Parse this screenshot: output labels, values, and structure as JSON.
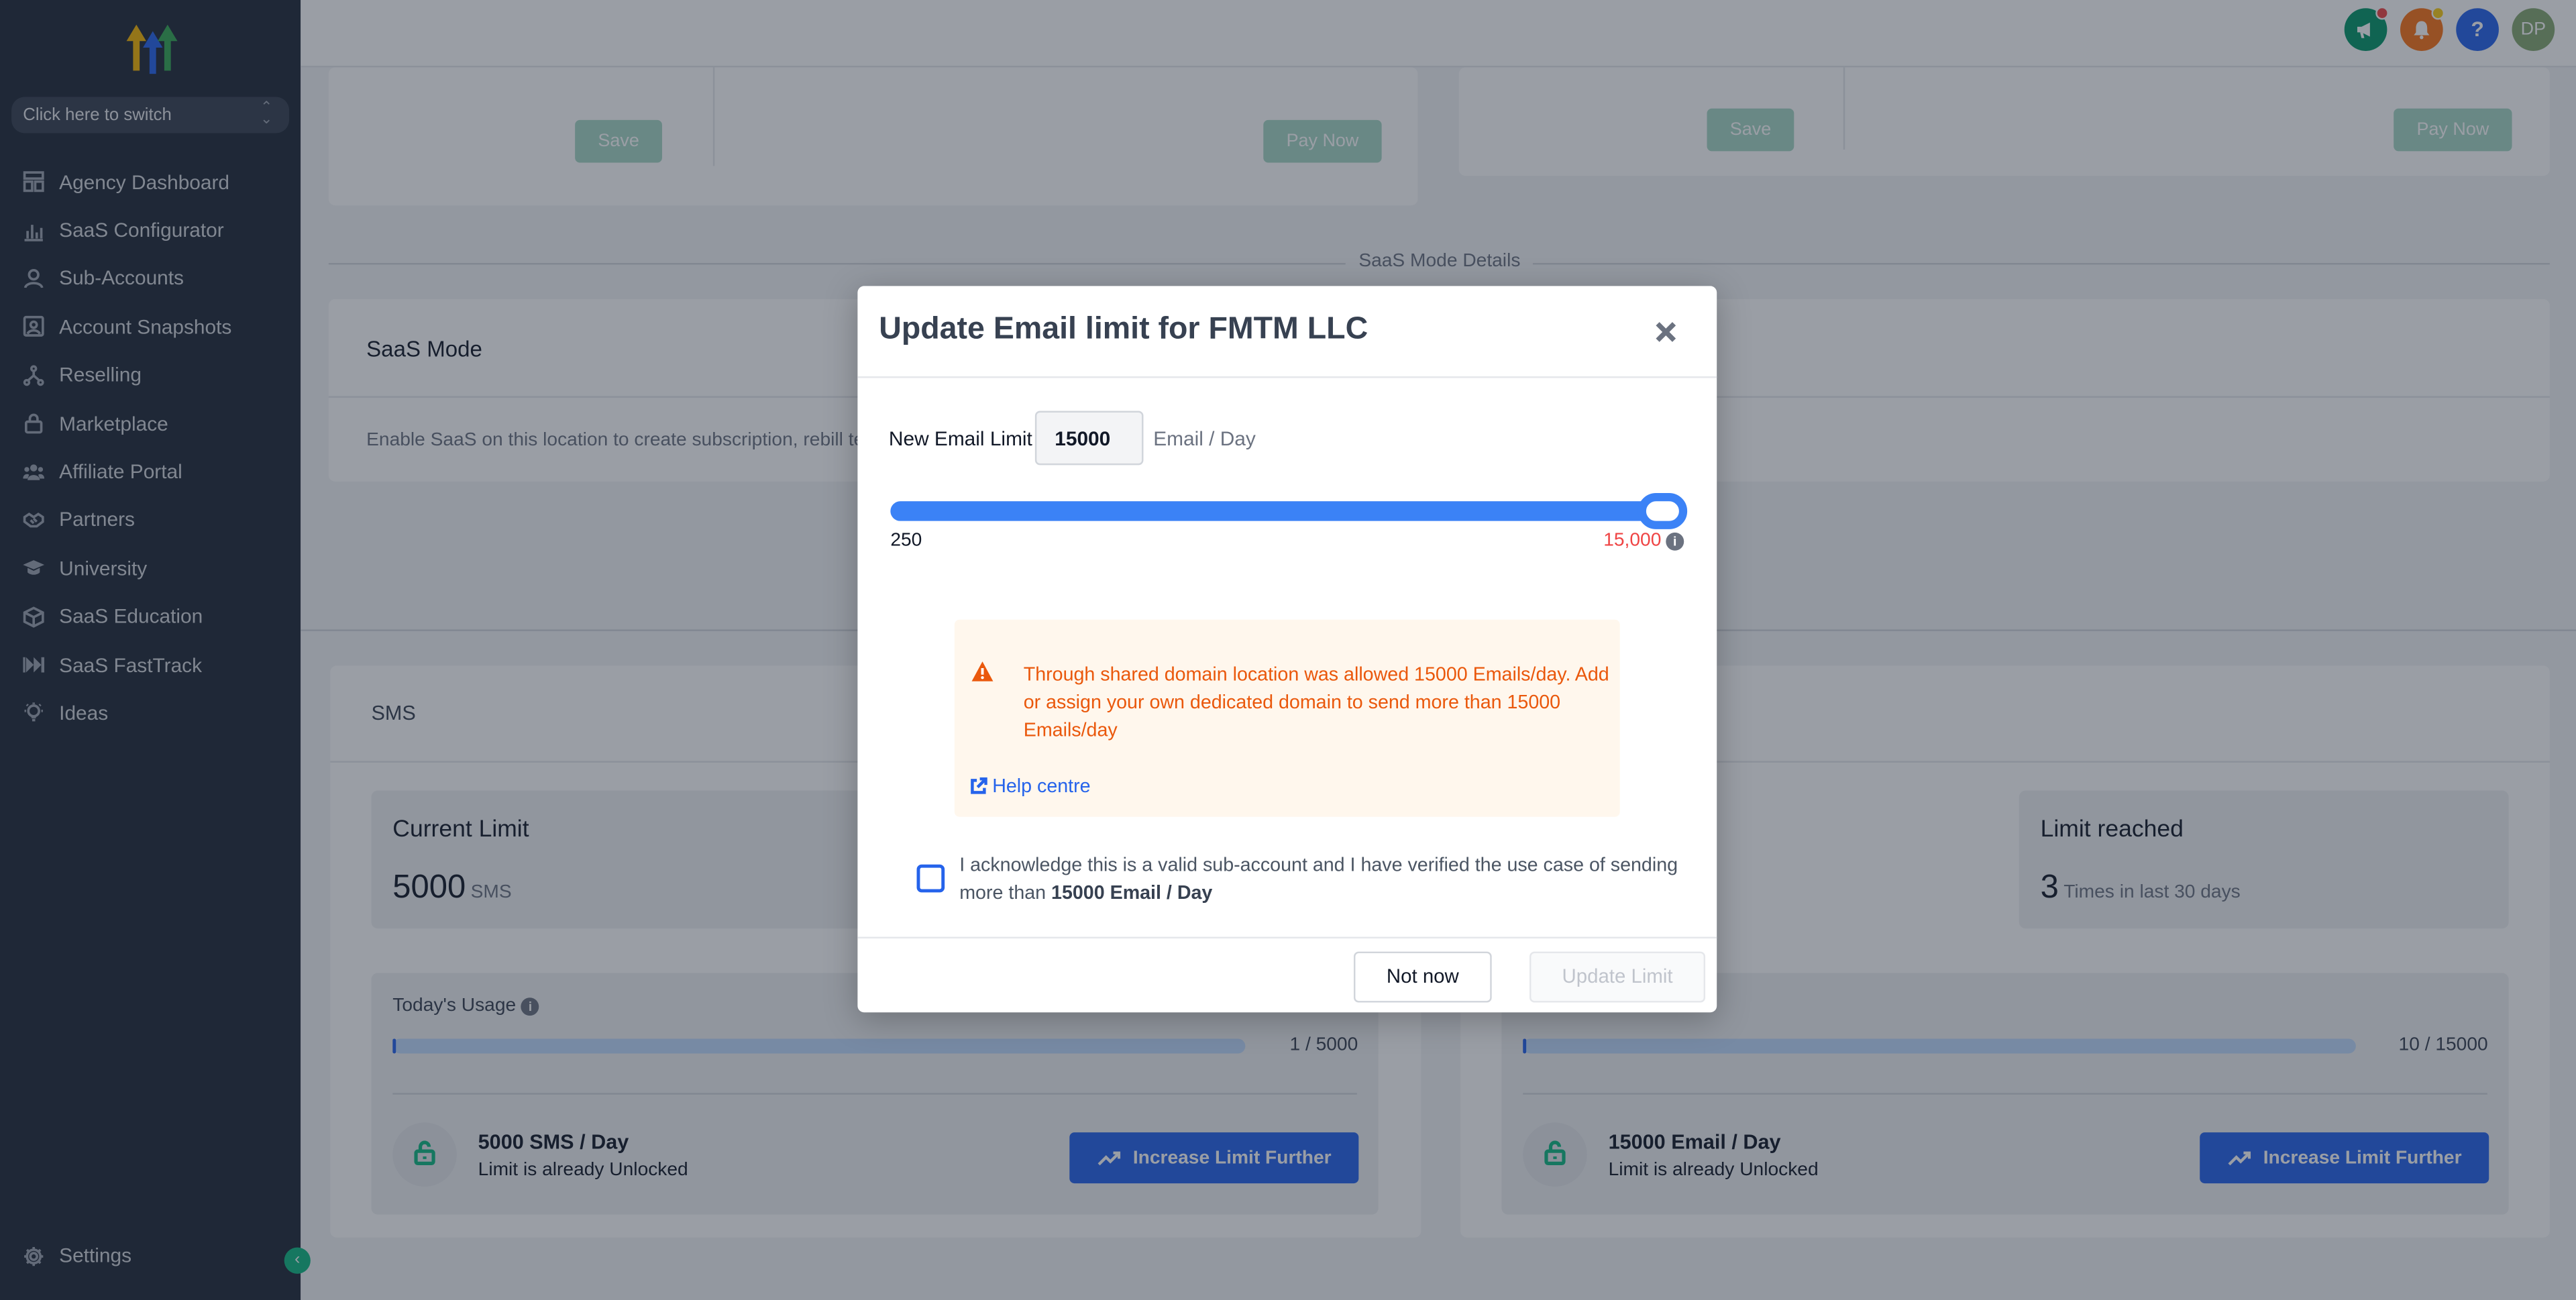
{
  "sidebar": {
    "switcher_label": "Click here to switch",
    "items": [
      {
        "label": "Agency Dashboard",
        "icon": "dashboard-icon"
      },
      {
        "label": "SaaS Configurator",
        "icon": "bar-chart-icon"
      },
      {
        "label": "Sub-Accounts",
        "icon": "user-icon"
      },
      {
        "label": "Account Snapshots",
        "icon": "snapshot-icon"
      },
      {
        "label": "Reselling",
        "icon": "reselling-icon"
      },
      {
        "label": "Marketplace",
        "icon": "lock-icon"
      },
      {
        "label": "Affiliate Portal",
        "icon": "users-icon"
      },
      {
        "label": "Partners",
        "icon": "handshake-icon"
      },
      {
        "label": "University",
        "icon": "graduation-cap-icon"
      },
      {
        "label": "SaaS Education",
        "icon": "cube-icon"
      },
      {
        "label": "SaaS FastTrack",
        "icon": "fast-forward-icon"
      },
      {
        "label": "Ideas",
        "icon": "lightbulb-icon"
      }
    ],
    "settings_label": "Settings"
  },
  "topbar": {
    "avatar_initials": "DP",
    "help_glyph": "?",
    "colors": {
      "announcement": "#059669",
      "notification": "#f97316",
      "help": "#2563eb",
      "avatar": "#86a872"
    }
  },
  "background": {
    "save_label": "Save",
    "pay_now_label": "Pay Now",
    "section_label": "SaaS Mode Details",
    "saas_mode_title": "SaaS Mode",
    "saas_mode_desc": "Enable SaaS on this location to create subscription, rebill te",
    "sms_title": "SMS",
    "sms_card": {
      "current_limit_title": "Current Limit",
      "current_limit_value": "5000",
      "current_limit_unit": "SMS",
      "usage_label": "Today's Usage",
      "usage_count": "1 / 5000",
      "usage_fraction": 0.0002,
      "limit_title": "5000 SMS / Day",
      "limit_sub": "Limit is already Unlocked",
      "increase_label": "Increase Limit Further"
    },
    "email_card": {
      "limit_reached_title": "Limit reached",
      "limit_reached_value": "3",
      "limit_reached_unit": "Times in last 30 days",
      "usage_count": "10 / 15000",
      "usage_fraction": 0.0007,
      "limit_title": "15000 Email / Day",
      "limit_sub": "Limit is already Unlocked",
      "increase_label": "Increase Limit Further"
    }
  },
  "modal": {
    "title": "Update Email limit for FMTM LLC",
    "new_limit_label": "New Email Limit",
    "new_limit_value": "15000",
    "unit_label": "Email / Day",
    "slider": {
      "min_label": "250",
      "max_label": "15,000",
      "min": 250,
      "max": 15000,
      "value": 15000
    },
    "warning_text": "Through shared domain location was allowed 15000 Emails/day. Add or assign your own dedicated domain to send more than 15000 Emails/day",
    "help_link": "Help centre",
    "ack_text": "I acknowledge this is a valid sub-account and I have verified the use case of sending more than ",
    "ack_bold": "15000 Email / Day",
    "not_now_label": "Not now",
    "update_label": "Update Limit"
  }
}
